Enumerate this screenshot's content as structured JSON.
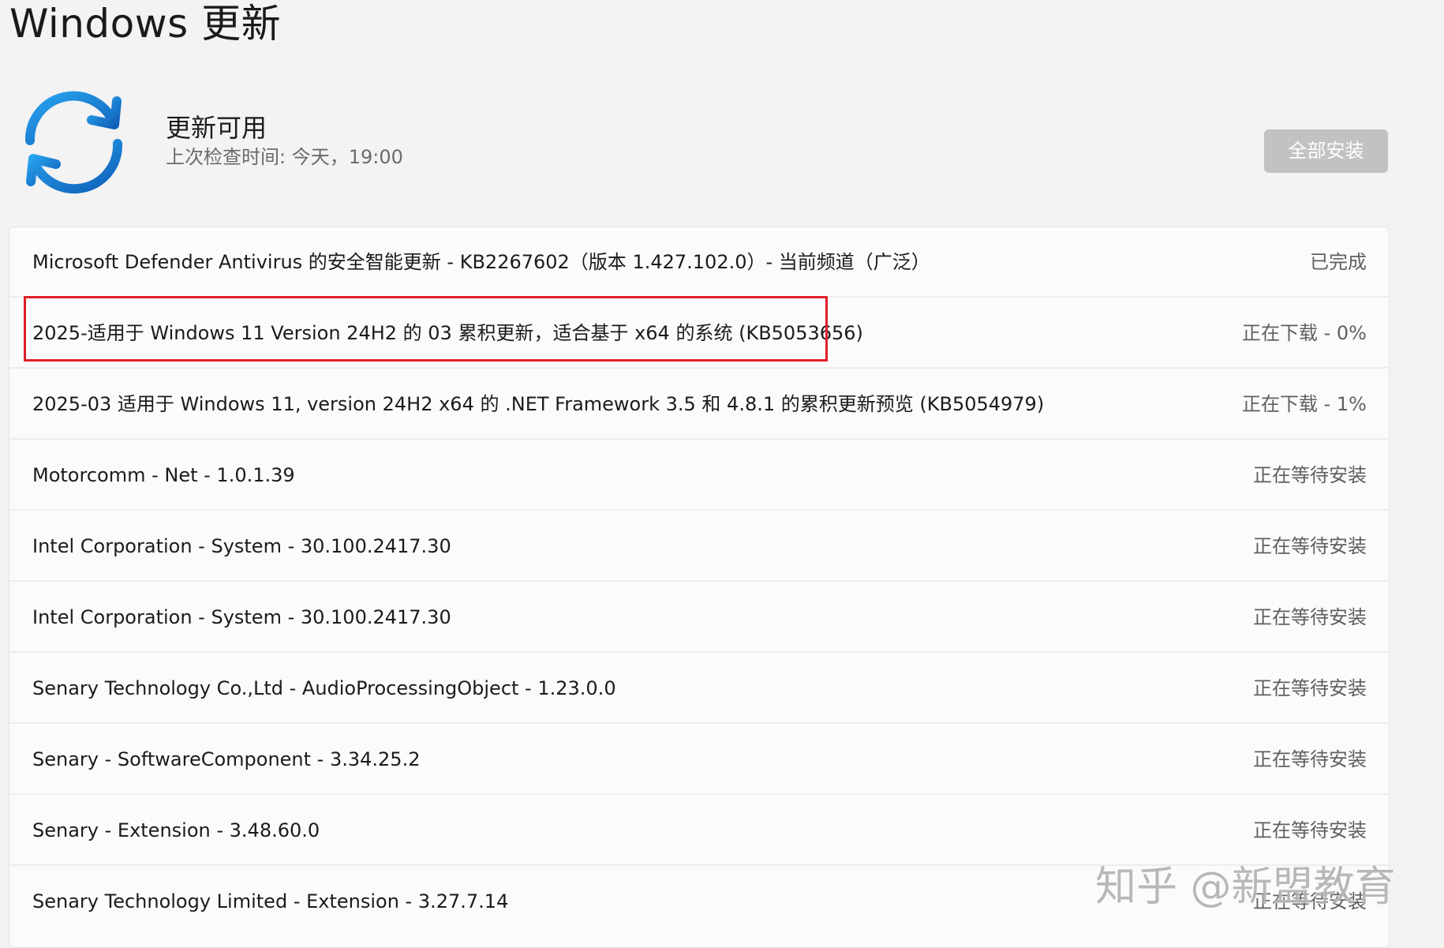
{
  "page": {
    "title": "Windows 更新"
  },
  "status": {
    "title": "更新可用",
    "subtitle": "上次检查时间: 今天，19:00",
    "install_all_label": "全部安装",
    "icon": "sync-icon"
  },
  "updates": [
    {
      "name": "Microsoft Defender Antivirus 的安全智能更新 - KB2267602（版本 1.427.102.0）- 当前频道（广泛）",
      "status": "已完成"
    },
    {
      "name": "2025-适用于 Windows 11 Version 24H2 的 03 累积更新，适合基于 x64 的系统 (KB5053656)",
      "status": "正在下载 - 0%",
      "highlighted": true
    },
    {
      "name": "2025-03 适用于 Windows 11, version 24H2 x64 的 .NET Framework 3.5 和 4.8.1 的累积更新预览 (KB5054979)",
      "status": "正在下载 - 1%"
    },
    {
      "name": "Motorcomm - Net - 1.0.1.39",
      "status": "正在等待安装"
    },
    {
      "name": "Intel Corporation - System - 30.100.2417.30",
      "status": "正在等待安装"
    },
    {
      "name": "Intel Corporation - System - 30.100.2417.30",
      "status": "正在等待安装"
    },
    {
      "name": "Senary Technology Co.,Ltd - AudioProcessingObject - 1.23.0.0",
      "status": "正在等待安装"
    },
    {
      "name": "Senary - SoftwareComponent - 3.34.25.2",
      "status": "正在等待安装"
    },
    {
      "name": "Senary - Extension - 3.48.60.0",
      "status": "正在等待安装"
    },
    {
      "name": "Senary Technology Limited - Extension - 3.27.7.14",
      "status": "正在等待安装"
    }
  ],
  "watermark": "知乎 @新盟教育",
  "colors": {
    "accent": "#1a7fd4",
    "highlight_border": "#e0202a",
    "button_disabled": "#c2c2c2"
  }
}
